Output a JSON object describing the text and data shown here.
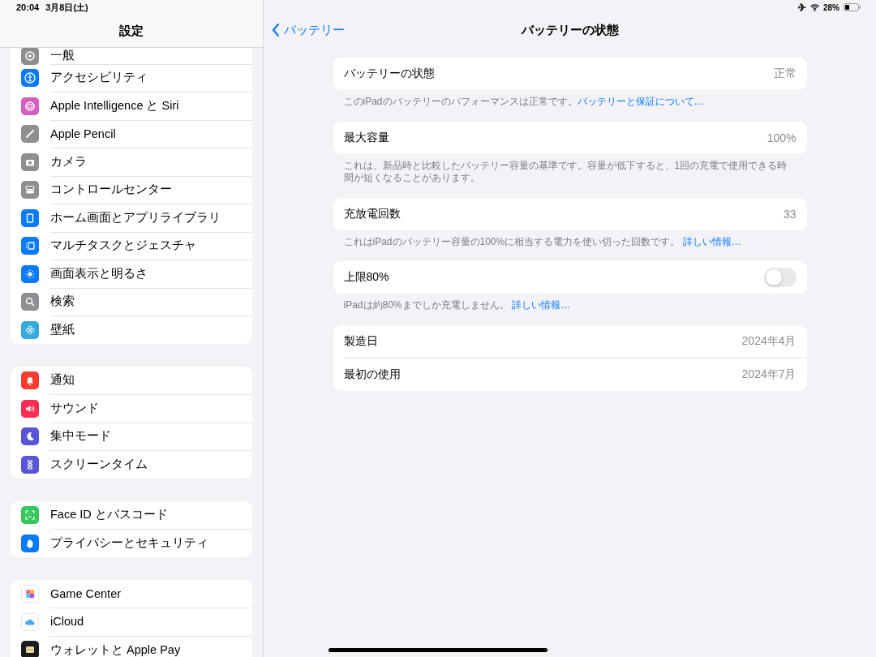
{
  "status_bar": {
    "time": "20:04",
    "date": "3月8日(土)",
    "battery": "28%"
  },
  "sidebar": {
    "title": "設定",
    "groups": [
      {
        "items": [
          {
            "label": "一般",
            "color": "#8e8e93"
          },
          {
            "label": "アクセシビリティ",
            "color": "#0a7aff"
          },
          {
            "label": "Apple Intelligence と Siri",
            "color": "#d45fc0"
          },
          {
            "label": "Apple Pencil",
            "color": "#8e8e93"
          },
          {
            "label": "カメラ",
            "color": "#8e8e93"
          },
          {
            "label": "コントロールセンター",
            "color": "#8e8e93"
          },
          {
            "label": "ホーム画面とアプリライブラリ",
            "color": "#0a7aff"
          },
          {
            "label": "マルチタスクとジェスチャ",
            "color": "#0a7aff"
          },
          {
            "label": "画面表示と明るさ",
            "color": "#0a7aff"
          },
          {
            "label": "検索",
            "color": "#8e8e93"
          },
          {
            "label": "壁紙",
            "color": "#35aadc"
          }
        ]
      },
      {
        "items": [
          {
            "label": "通知",
            "color": "#ff3b30"
          },
          {
            "label": "サウンド",
            "color": "#ff2d55"
          },
          {
            "label": "集中モード",
            "color": "#5856d6"
          },
          {
            "label": "スクリーンタイム",
            "color": "#5856d6"
          }
        ]
      },
      {
        "items": [
          {
            "label": "Face ID とパスコード",
            "color": "#34c759"
          },
          {
            "label": "プライバシーとセキュリティ",
            "color": "#0a7aff"
          }
        ]
      },
      {
        "items": [
          {
            "label": "Game Center",
            "color": "#ffffff"
          },
          {
            "label": "iCloud",
            "color": "#ffffff"
          },
          {
            "label": "ウォレットと Apple Pay",
            "color": "#1c1c1e"
          }
        ]
      }
    ]
  },
  "detail": {
    "back": "バッテリー",
    "title": "バッテリーの状態",
    "sections": [
      {
        "kind": "value",
        "rows": [
          {
            "label": "バッテリーの状態",
            "value": "正常"
          }
        ],
        "footer": "このiPadのバッテリーのパフォーマンスは正常です。",
        "link": "バッテリーと保証について…"
      },
      {
        "kind": "value",
        "rows": [
          {
            "label": "最大容量",
            "value": "100%"
          }
        ],
        "footer": "これは、新品時と比較したバッテリー容量の基準です。容量が低下すると、1回の充電で使用できる時間が短くなることがあります。"
      },
      {
        "kind": "value",
        "rows": [
          {
            "label": "充放電回数",
            "value": "33"
          }
        ],
        "footer": "これはiPadのバッテリー容量の100%に相当する電力を使い切った回数です。 ",
        "link": "詳しい情報…"
      },
      {
        "kind": "toggle",
        "rows": [
          {
            "label": "上限80%",
            "on": false
          }
        ],
        "footer": "iPadは約80%までしか充電しません。 ",
        "link": "詳しい情報…"
      },
      {
        "kind": "value",
        "rows": [
          {
            "label": "製造日",
            "value": "2024年4月"
          },
          {
            "label": "最初の使用",
            "value": "2024年7月"
          }
        ]
      }
    ]
  }
}
